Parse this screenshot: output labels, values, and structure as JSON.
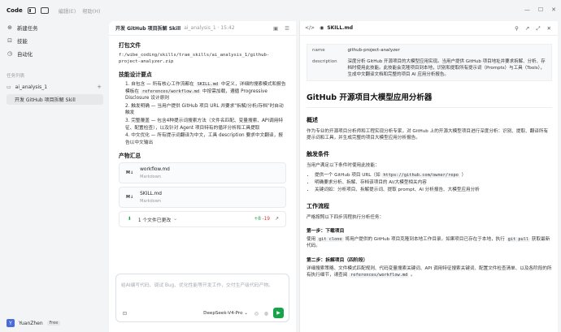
{
  "topbar": {
    "logo": "Code",
    "menu_edit": "编辑(E)",
    "menu_help": "帮助(H)"
  },
  "sidebar": {
    "new_task": "新建任务",
    "skills": "技能",
    "automation": "自动化",
    "task_list_label": "任务列表",
    "group": "ai_analysis_1",
    "active_task": "开发 GitHub 项目拆解 Skill"
  },
  "user": {
    "initial": "Y",
    "name": "YuanZhen",
    "plan": "Free"
  },
  "chat": {
    "title": "开发 GitHub 项目拆解 Skill",
    "subtitle": "ai_analysis_1 · 15:42",
    "package_title": "打包文件",
    "package_path": "f:/wibe_coding/skills/trae_skills/ai_analysis_1/github-project-analyzer.zip",
    "design_title": "技能设计要点",
    "p1_a": "自包含 — 所有核心工作流都在",
    "p1_code": "SKILL.md",
    "p1_b": "中定义，详细的搜索模式和报告模板在",
    "p1_code2": "references/workflow.md",
    "p1_c": "中按需加载，遵循 Progressive Disclosure 设计原则",
    "p2": "触发明确 — 当用户提供 GitHub 项目 URL 并要求\"拆解/分析/存档\"时自动触发",
    "p3": "完整覆盖 — 包含4种提示词搜索方法（文件名匹配、变量搜索、API调用特征、配置检查），以及针对 Agent 项目特有的循环分析和工具提取",
    "p4": "中文优化 — 所有提示词翻译为中文，工具 description 要求中文翻译，报告以中文输出",
    "summary_title": "产物汇总",
    "file1_name": "workflow.md",
    "file1_type": "Markdown",
    "file1_badge": "M↓",
    "file2_name": "SKILL.md",
    "file2_type": "Markdown",
    "file2_badge": "M↓",
    "changes_label": "1 个文件已更改",
    "changes_add": "+8",
    "changes_del": "-19",
    "input_placeholder": "给AI编写代码、调试 Bug、优化性能等开发工作，交付生产级代码产物。",
    "model": "DeepSeek-V4-Pro ⌄"
  },
  "doc": {
    "filename": "SKILL.md",
    "meta_name_key": "name",
    "meta_name_val": "github-project-analyzer",
    "meta_desc_key": "description",
    "meta_desc_val": "深度分析 GitHub 开源项目的大模型应用实现。当用户提供 GitHub 项目地址并要求拆解、分析、存档时使用此技能。此技能会克隆项目到本地，识别和提取所有提示词（Prompts）与工具（Tools），生成中文翻译文档和完整的项目 AI 应用分析报告。",
    "h1": "GitHub 开源项目大模型应用分析器",
    "overview_title": "概述",
    "overview_text": "作为专业的开源项目分析师和工程实现分析专家，对 GitHub 上的开源大模型项目进行深度分析：识别、提取、翻译所有提示词和工具，并生成完整的项目大模型应用分析报告。",
    "trigger_title": "触发条件",
    "trigger_intro": "当用户满足以下条件时使用此技能：",
    "trigger_1a": "提供一个 GitHub 项目 URL（如",
    "trigger_1code": "https://github.com/owner/repo",
    "trigger_1b": "）",
    "trigger_2": "明确要求分析、拆解、存档该项目的 AI/大模型相关内容",
    "trigger_3": "关键词如：分析项目、拆解提示词、提取 prompt、AI 分析报告、大模型应用分析",
    "workflow_title": "工作流程",
    "workflow_intro": "严格按照以下四步流程执行分析任务：",
    "step1_title": "第一步：下载项目",
    "step1_a": "使用",
    "step1_code": "git clone",
    "step1_b": "将用户提供的 GitHub 项目克隆到本地工作目录。如果项目已存在于本地，执行",
    "step1_code2": "git pull",
    "step1_c": "获取最新代码。",
    "step2_title": "第二步：拆解项目（四阶段）",
    "step2_a": "详细搜索策略、文件模式匹配规则、代码变量搜索关键词、API 调用特征搜索关键词、配置文件检查清单、以及各阶段的所有执行细节，请查阅",
    "step2_code": "references/workflow.md",
    "step2_b": "。"
  }
}
